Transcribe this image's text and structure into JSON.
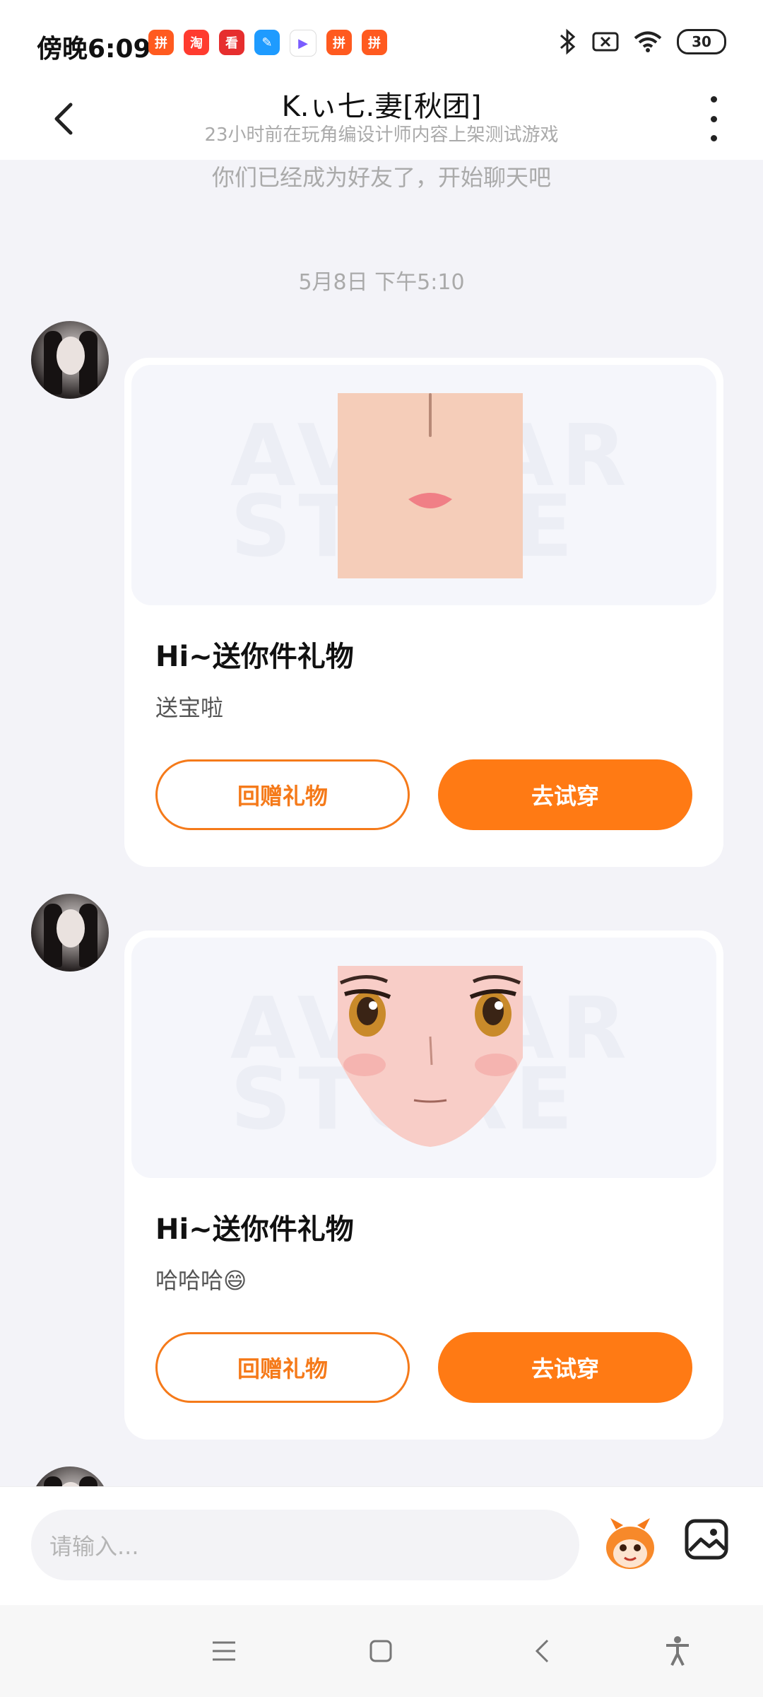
{
  "status_bar": {
    "time": "傍晚6:09",
    "battery": "30",
    "app_icons": [
      {
        "name": "pdd-icon",
        "color": "#ff5a1f",
        "glyph": "拼"
      },
      {
        "name": "taobao-icon",
        "color": "#ff3b2f",
        "glyph": "淘"
      },
      {
        "name": "kandian-icon",
        "color": "#e62e2e",
        "glyph": "看"
      },
      {
        "name": "notes-icon",
        "color": "#1e9bff",
        "glyph": "✎"
      },
      {
        "name": "video-icon",
        "color": "#ffffff",
        "glyph": "▶"
      },
      {
        "name": "pdd-icon-2",
        "color": "#ff5a1f",
        "glyph": "拼"
      },
      {
        "name": "pdd-icon-3",
        "color": "#ff5a1f",
        "glyph": "拼"
      }
    ]
  },
  "header": {
    "title": "K.ぃ七.妻[秋团]",
    "subtitle": "23小时前在玩角编设计师内容上架测试游戏"
  },
  "chat": {
    "system_note": "你们已经成为好友了，开始聊天吧",
    "timestamp": "5月8日 下午5:10",
    "messages": [
      {
        "watermark": "AVATAR STORE",
        "title": "Hi~送你件礼物",
        "text": "送宝啦",
        "btn_return": "回赠礼物",
        "btn_try": "去试穿"
      },
      {
        "watermark": "AVATAR STORE",
        "title": "Hi~送你件礼物",
        "text": "哈哈哈😄",
        "btn_return": "回赠礼物",
        "btn_try": "去试穿"
      }
    ]
  },
  "input_bar": {
    "placeholder": "请输入..."
  },
  "colors": {
    "accent": "#ff7a14",
    "background": "#f3f3f8"
  }
}
